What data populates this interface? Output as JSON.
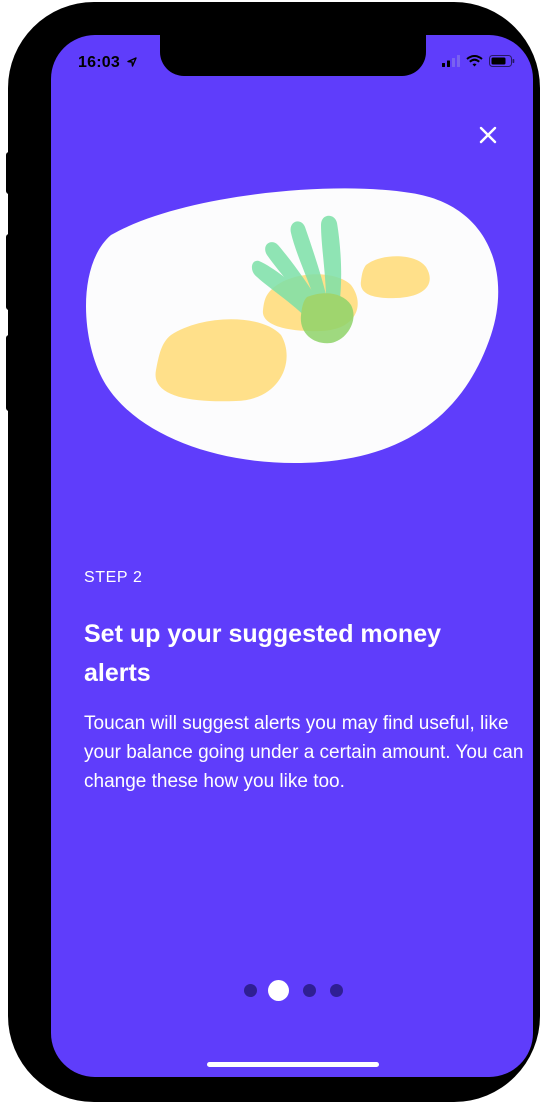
{
  "status_bar": {
    "time": "16:03",
    "icons": [
      "location-arrow-icon",
      "signal-icon",
      "wifi-icon",
      "battery-icon"
    ]
  },
  "close_icon": "close-icon",
  "onboarding": {
    "step_label": "STEP 2",
    "title": "Set up your suggested money alerts",
    "description": "Toucan will suggest alerts you may find useful, like your balance going under a certain amount. You can change these how you like too."
  },
  "pagination": {
    "total": 4,
    "current": 2
  },
  "colors": {
    "background": "#5f3dfb",
    "plate": "#fcfcfd",
    "coin": "#ffe08a",
    "leaf": "#7de0a8",
    "dot_inactive": "#2f1f93",
    "dot_active": "#ffffff"
  }
}
